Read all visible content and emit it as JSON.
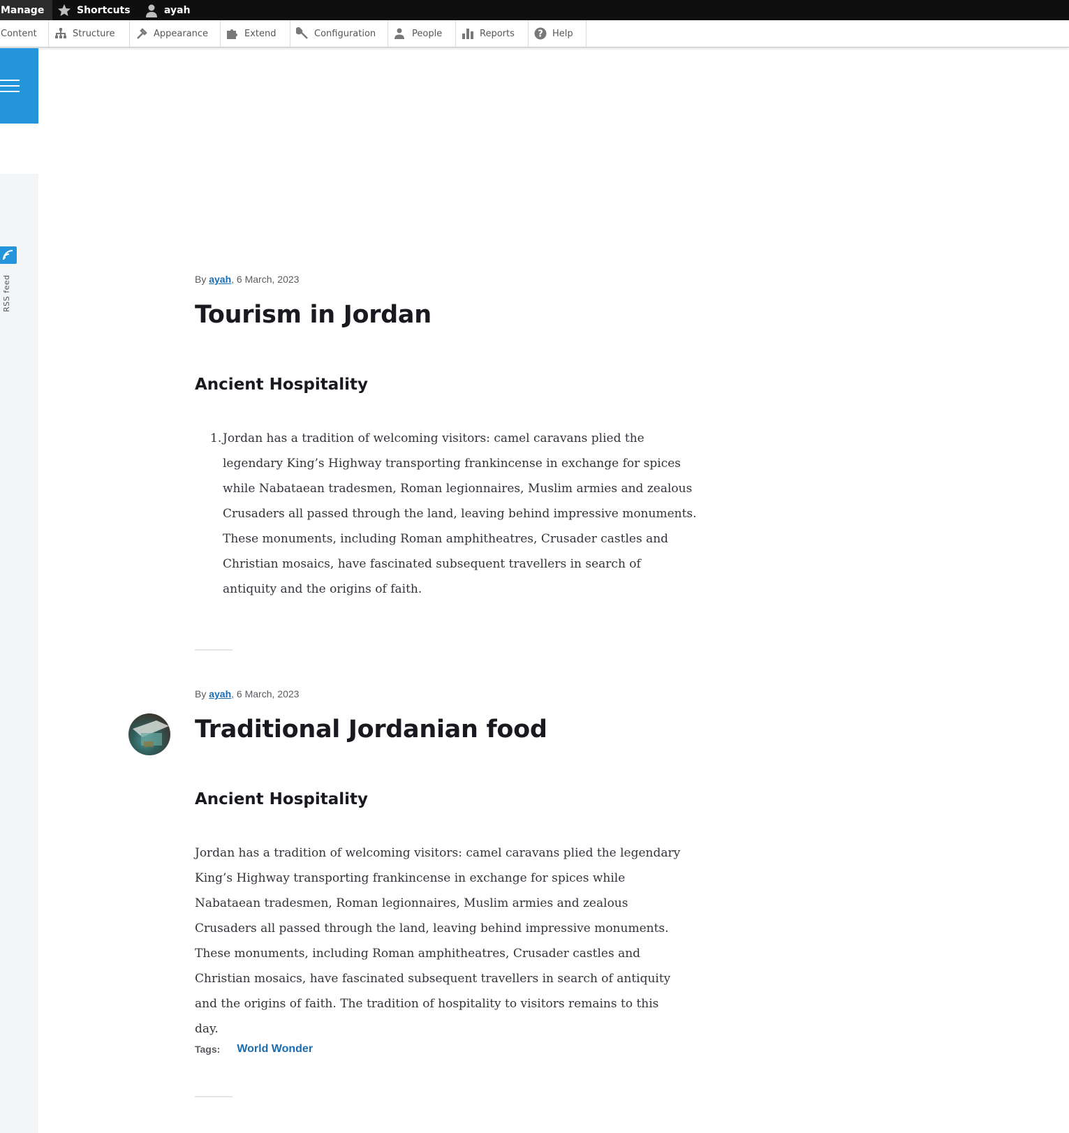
{
  "toolbar": {
    "manage": "Manage",
    "shortcuts": "Shortcuts",
    "user": "ayah"
  },
  "tray": {
    "items": [
      {
        "label": "Content",
        "icon": "none"
      },
      {
        "label": "Structure",
        "icon": "structure-icon"
      },
      {
        "label": "Appearance",
        "icon": "appearance-icon"
      },
      {
        "label": "Extend",
        "icon": "puzzle-icon"
      },
      {
        "label": "Configuration",
        "icon": "wrench-icon"
      },
      {
        "label": "People",
        "icon": "people-icon"
      },
      {
        "label": "Reports",
        "icon": "bar-chart-icon"
      },
      {
        "label": "Help",
        "icon": "help-icon"
      }
    ]
  },
  "sidebar": {
    "rss_label": "RSS feed"
  },
  "articles": [
    {
      "by": "By ",
      "author": "ayah",
      "date": ", 6 March, 2023",
      "title": "Tourism in Jordan",
      "subheading": "Ancient Hospitality",
      "list_number": "1.",
      "body": "Jordan has a tradition of welcoming visitors: camel caravans plied the legendary King’s Highway transporting frankincense in exchange for spices while Nabataean tradesmen, Roman legionnaires, Muslim armies and zealous Crusaders all passed through the land, leaving behind impressive monuments. These monuments, including Roman amphitheatres, Crusader castles and Christian mosaics, have fascinated subsequent travellers in search of antiquity and the origins of faith."
    },
    {
      "by": "By ",
      "author": "ayah",
      "date": ", 6 March, 2023",
      "title": "Traditional Jordanian food",
      "subheading": "Ancient Hospitality",
      "body": "Jordan has a tradition of welcoming visitors: camel caravans plied the legendary King’s Highway transporting frankincense in exchange for spices while Nabataean tradesmen, Roman legionnaires, Muslim armies and zealous Crusaders all passed through the land, leaving behind impressive monuments. These monuments, including Roman amphitheatres, Crusader castles and Christian mosaics, have fascinated subsequent travellers in search of antiquity and the origins of faith. The tradition of hospitality to visitors remains to this day.",
      "tags_label": "Tags:",
      "tag": "World Wonder"
    }
  ],
  "colors": {
    "accent": "#2494db",
    "link": "#1a6db1",
    "toolbar_bg": "#0f0f0f"
  }
}
